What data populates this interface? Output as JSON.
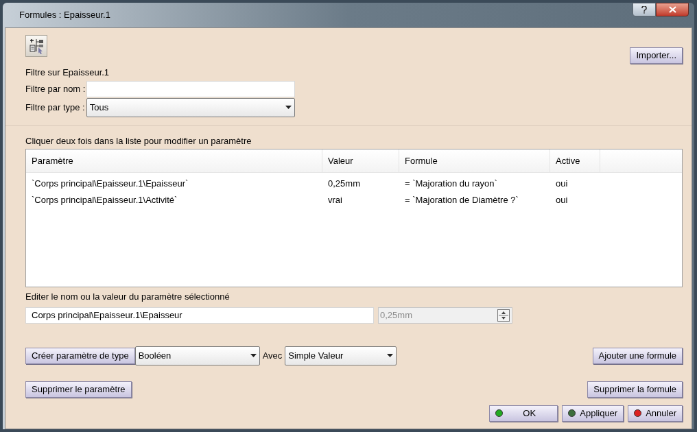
{
  "window": {
    "title": "Formules : Epaisseur.1"
  },
  "import_button": "Importer...",
  "filter": {
    "heading": "Filtre sur Epaisseur.1",
    "name_label": "Filtre par nom :",
    "type_label": "Filtre par type :",
    "type_value": "Tous"
  },
  "list_hint": "Cliquer deux fois dans la liste pour modifier un paramètre",
  "table": {
    "columns": [
      "Paramètre",
      "Valeur",
      "Formule",
      "Active"
    ],
    "rows": [
      {
        "cells": [
          "`Corps principal\\Epaisseur.1\\Epaisseur`",
          "0,25mm",
          "= `Majoration du rayon`",
          "oui"
        ],
        "selected": false
      },
      {
        "cells": [
          "`Corps principal\\Epaisseur.1\\Activité`",
          "vrai",
          "= `Majoration de Diamètre ?`",
          "oui"
        ],
        "selected": false
      }
    ]
  },
  "edit": {
    "label": "Editer le nom ou la valeur du paramètre sélectionné",
    "name_value": "Corps principal\\Epaisseur.1\\Epaisseur",
    "value": "0,25mm",
    "value_disabled": true
  },
  "create": {
    "button": "Créer paramètre de type",
    "type_value": "Booléen",
    "with_label": "Avec",
    "with_value": "Simple Valeur"
  },
  "add_formula_button": "Ajouter une formule",
  "delete_parameter_button": "Supprimer le paramètre",
  "delete_formula_button": "Supprimer la formule",
  "dialog_buttons": [
    {
      "label": "OK",
      "color": "#22aa22"
    },
    {
      "label": "Appliquer",
      "color": "#3c6e3c"
    },
    {
      "label": "Annuler",
      "color": "#dd2222"
    }
  ]
}
